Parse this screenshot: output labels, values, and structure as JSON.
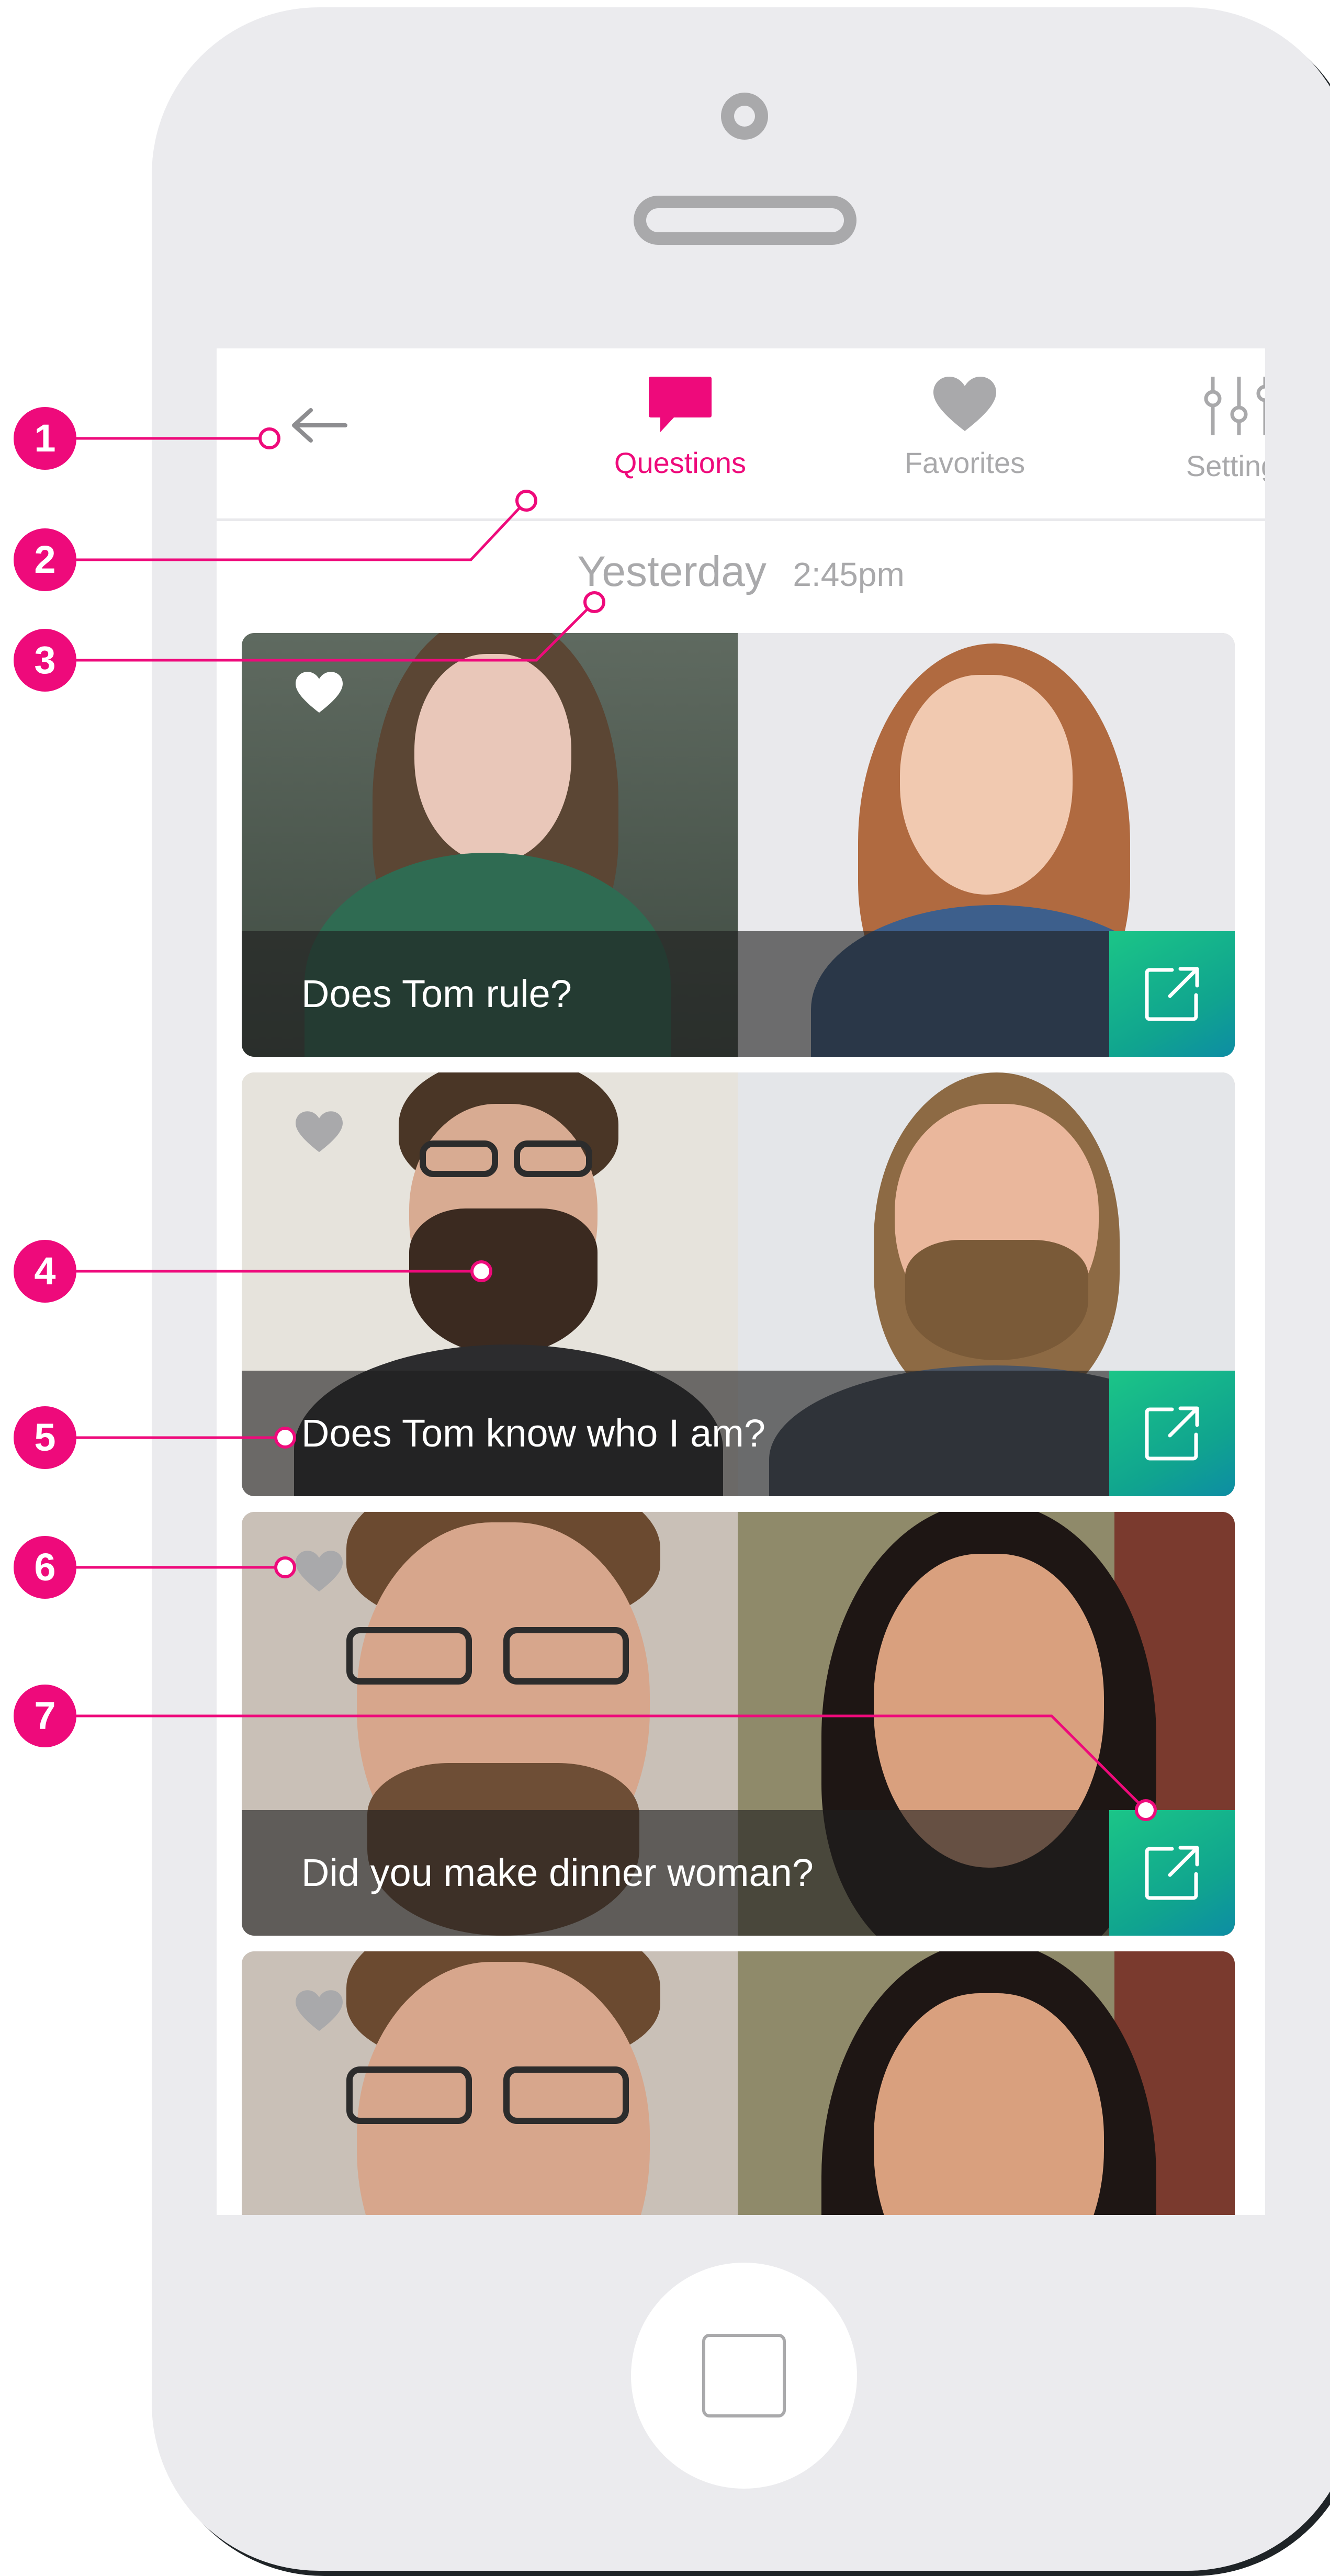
{
  "nav": {
    "back_icon": "arrow-left-icon",
    "tabs": [
      {
        "label": "Questions",
        "icon": "chat-bubble-icon",
        "active": true
      },
      {
        "label": "Favorites",
        "icon": "heart-icon",
        "active": false
      },
      {
        "label": "Settings",
        "icon": "sliders-icon",
        "active": false
      }
    ]
  },
  "feed": {
    "date": "Yesterday",
    "time": "2:45pm",
    "cards": [
      {
        "caption": "Does Tom rule?",
        "favorited": true,
        "share_icon": "external-link-icon"
      },
      {
        "caption": "Does Tom know who I am?",
        "favorited": false,
        "share_icon": "external-link-icon"
      },
      {
        "caption": "Did you make dinner woman?",
        "favorited": false,
        "share_icon": "external-link-icon"
      },
      {
        "caption": "",
        "favorited": false,
        "share_icon": ""
      }
    ]
  },
  "annotations": {
    "badges": [
      "1",
      "2",
      "3",
      "4",
      "5",
      "6",
      "7"
    ]
  },
  "colors": {
    "accent": "#ee0a7b",
    "inactive": "#a9a9ab",
    "share_gradient_start": "#1bc587",
    "share_gradient_end": "#0d8da4",
    "phone_body": "#ebebee"
  }
}
